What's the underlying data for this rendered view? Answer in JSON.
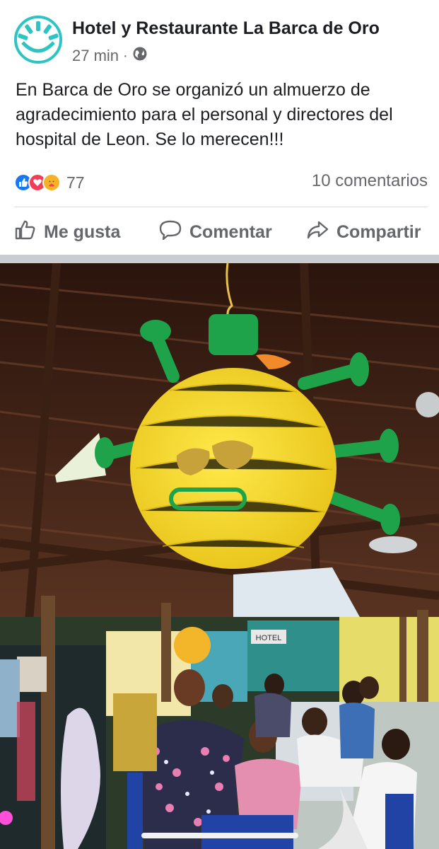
{
  "post": {
    "page_name": "Hotel y Restaurante La Barca de Oro",
    "time": "27 min",
    "separator": "·",
    "audience_icon": "globe-icon",
    "text": "En Barca de Oro se organizó un almuerzo de agradecimiento para el personal y directores del hospital de Leon. Se lo merecen!!!"
  },
  "stats": {
    "reaction_icons": [
      "like-icon",
      "love-icon",
      "care-icon"
    ],
    "reaction_count": "77",
    "comments": "10 comentarios"
  },
  "actions": {
    "like": "Me gusta",
    "comment": "Comentar",
    "share": "Compartir"
  },
  "photo": {
    "sign_text": "HOTEL"
  },
  "colors": {
    "text": "#1c1e21",
    "secondary": "#65676b",
    "like_blue": "#1877f2",
    "love_red": "#f33e58",
    "care_yellow": "#f7b125",
    "avatar_teal": "#2ec4c4"
  }
}
